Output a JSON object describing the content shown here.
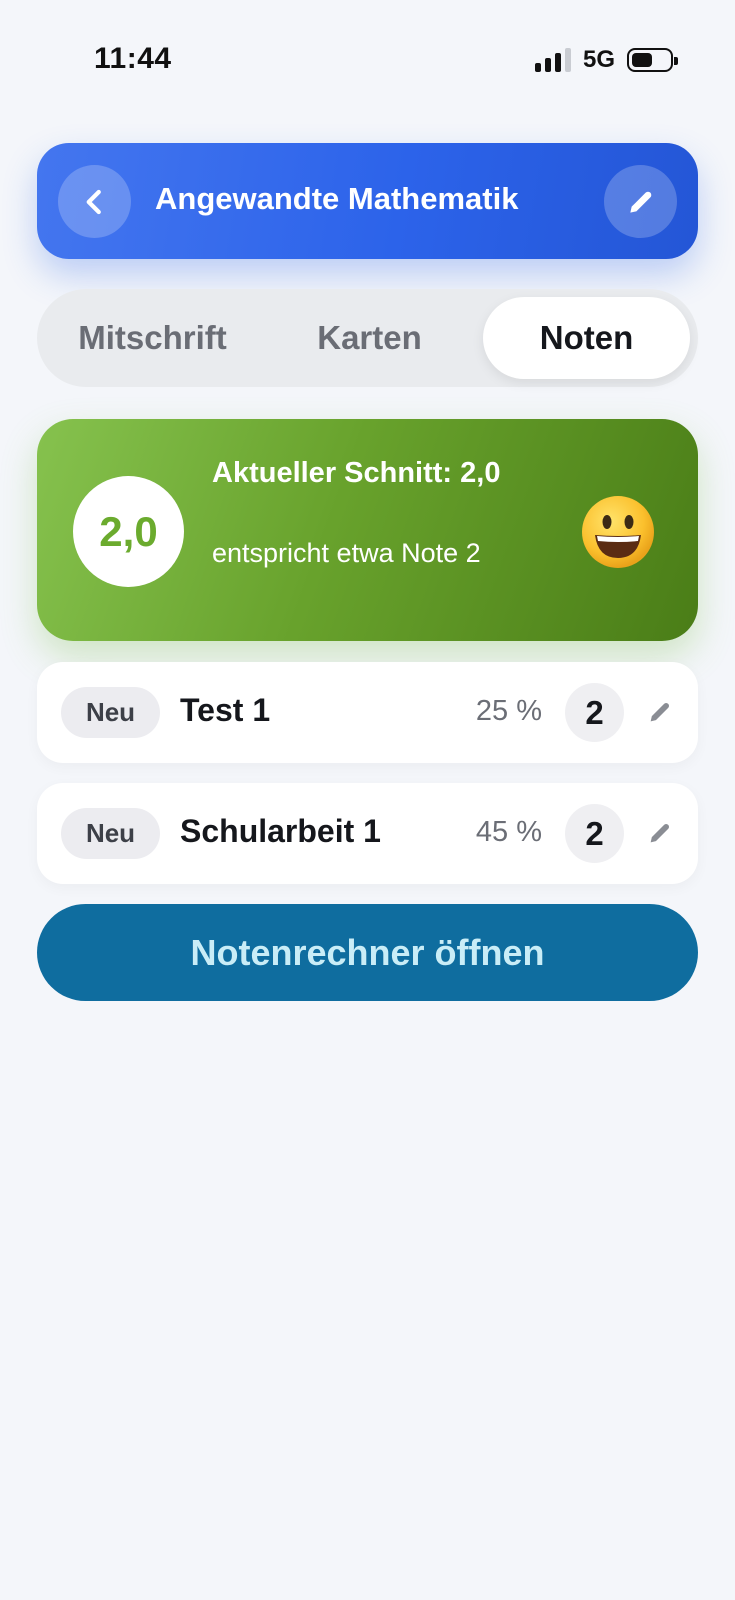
{
  "status": {
    "time": "11:44",
    "network": "5G",
    "signal_bars": 4,
    "signal_active": 3,
    "battery_level": 0.55
  },
  "header": {
    "title": "Angewandte Mathematik",
    "back_icon": "chevron-left-icon",
    "edit_icon": "pencil-icon",
    "color": "#2c63ea"
  },
  "tabs": [
    {
      "label": "Mitschrift",
      "active": false
    },
    {
      "label": "Karten",
      "active": false
    },
    {
      "label": "Noten",
      "active": true
    }
  ],
  "summary": {
    "average": "2,0",
    "title": "Aktueller Schnitt: 2,0",
    "subtitle": "entspricht etwa Note 2",
    "emoji_icon": "grinning-face-icon",
    "color": "#68a22c"
  },
  "grades": [
    {
      "badge": "Neu",
      "title": "Test 1",
      "weight": "25 %",
      "grade": "2"
    },
    {
      "badge": "Neu",
      "title": "Schularbeit 1",
      "weight": "45 %",
      "grade": "2"
    }
  ],
  "calculator": {
    "label": "Notenrechner öffnen",
    "color": "#0f6d9f"
  }
}
